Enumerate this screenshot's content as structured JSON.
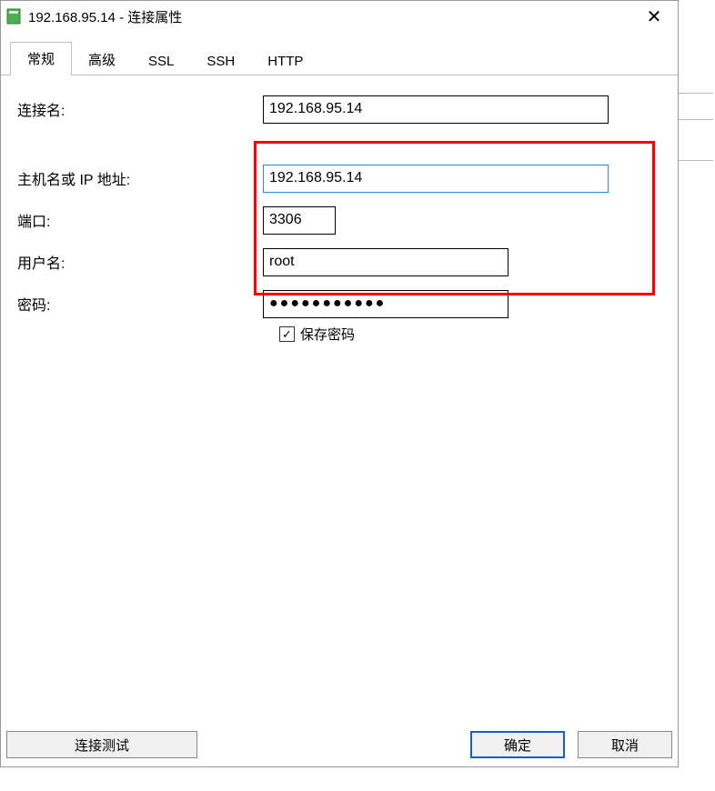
{
  "titlebar": {
    "title": "192.168.95.14 - 连接属性"
  },
  "tabs": {
    "general": "常规",
    "advanced": "高级",
    "ssl": "SSL",
    "ssh": "SSH",
    "http": "HTTP"
  },
  "form": {
    "connection_name": {
      "label": "连接名:",
      "value": "192.168.95.14"
    },
    "host": {
      "label": "主机名或 IP 地址:",
      "value": "192.168.95.14"
    },
    "port": {
      "label": "端口:",
      "value": "3306"
    },
    "username": {
      "label": "用户名:",
      "value": "root"
    },
    "password": {
      "label": "密码:",
      "value": "●●●●●●●●●●●"
    },
    "save_password": {
      "label": "保存密码",
      "checked": true,
      "checkmark": "✓"
    }
  },
  "buttons": {
    "test": "连接测试",
    "ok": "确定",
    "cancel": "取消"
  },
  "icons": {
    "close": "✕"
  }
}
